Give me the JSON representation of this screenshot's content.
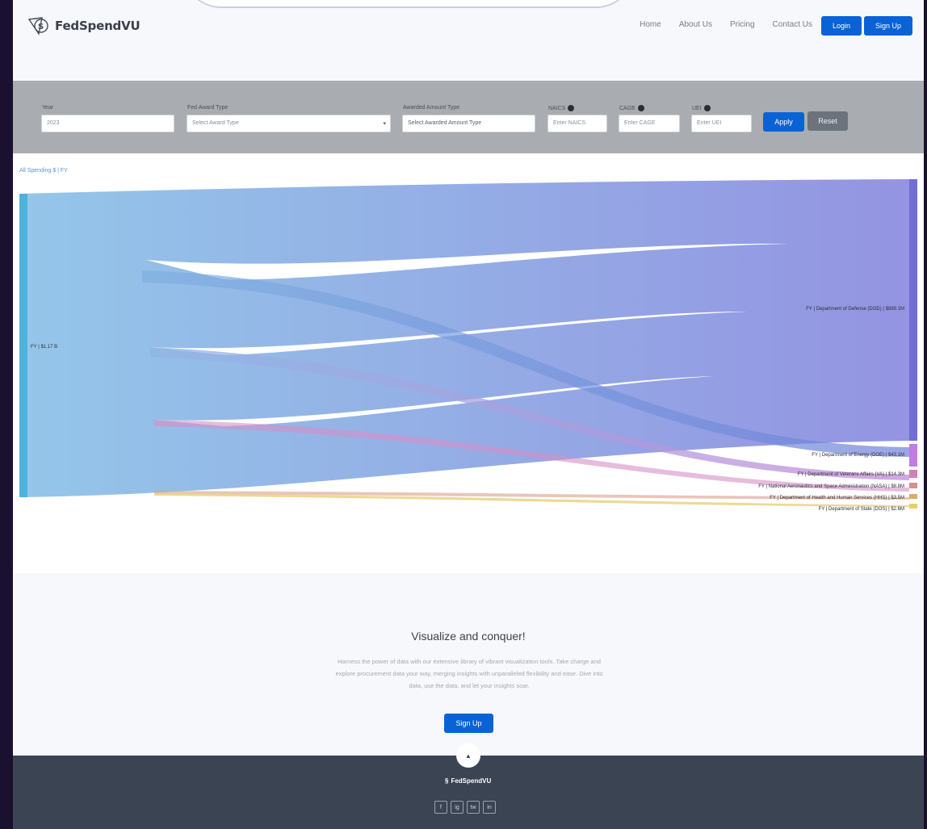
{
  "brand": {
    "name": "FedSpendVU"
  },
  "nav": {
    "links": [
      "Home",
      "About Us",
      "Pricing",
      "Contact Us"
    ],
    "login": "Login",
    "signup": "Sign Up"
  },
  "filters": {
    "year": {
      "label": "Year",
      "value": "2023"
    },
    "fund_award": {
      "label": "Fed Award Type",
      "value": "Select Award Type"
    },
    "awarded": {
      "label": "Awarded Amount Type",
      "value": "Select Awarded Amount Type"
    },
    "naics": {
      "label": "NAICS",
      "value": "Enter NAICS"
    },
    "cage": {
      "label": "CAGE",
      "value": "Enter CAGE"
    },
    "uei": {
      "label": "UEI",
      "value": "Enter UEI"
    },
    "apply": "Apply",
    "reset": "Reset"
  },
  "breadcrumb": "All Spending $ | FY",
  "sankey": {
    "source": {
      "label": "FY | $1.17 B"
    },
    "targets": [
      {
        "label": "FY | Department of Defense (DOD) | $889.1M",
        "color": "#7b7ed9",
        "fraction": 0.8
      },
      {
        "label": "FY | Department of Energy (DOE) | $43.1M",
        "color": "#c07de0",
        "fraction": 0.066
      },
      {
        "label": "FY | Department of Veterans Affairs (VA) | $14.3M",
        "color": "#d27fb7",
        "fraction": 0.03
      },
      {
        "label": "FY | National Aeronautics and Space Administration (NASA) | $8.8M",
        "color": "#d98f8f",
        "fraction": 0.02
      },
      {
        "label": "FY | Department of Health and Human Services (HHS) | $3.5M",
        "color": "#e0a96b",
        "fraction": 0.014
      },
      {
        "label": "FY | Department of State (DOS) | $2.6M",
        "color": "#e8cf6b",
        "fraction": 0.012
      }
    ]
  },
  "cta": {
    "title": "Visualize and conquer!",
    "body": "Harness the power of data with our extensive library of vibrant visualization tools. Take charge and explore procurement data your way, merging insights with unparalleled flexibility and ease. Dive into data, use the data, and let your insights soar.",
    "button": "Sign Up"
  },
  "footer": {
    "brand": "FedSpendVU",
    "socials": [
      "f",
      "ig",
      "tw",
      "in"
    ]
  },
  "colors": {
    "primary": "#0a63d6",
    "footer": "#3b4453",
    "filter_bar": "#a9adb2"
  }
}
